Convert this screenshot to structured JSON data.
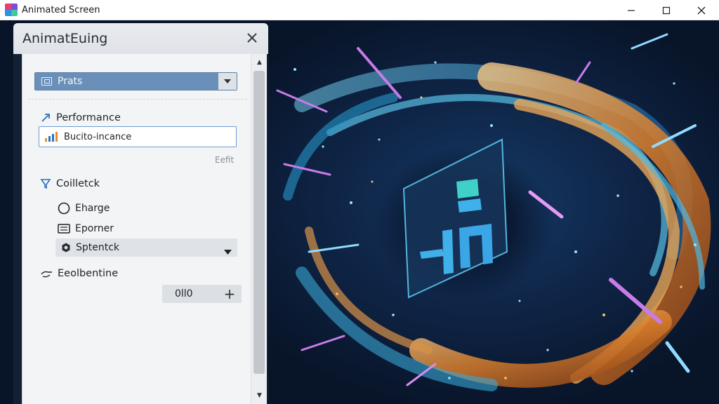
{
  "window": {
    "title": "Animated Screen",
    "controls": [
      "minimize",
      "maximize",
      "close"
    ]
  },
  "panel": {
    "title": "AnimatEuing",
    "top_dropdown": {
      "value": "Prats",
      "icon": "image-frame-icon"
    },
    "performance": {
      "label": "Performance",
      "input_value": "Bucito-incance",
      "edit_label": "Eefit"
    },
    "collection": {
      "label": "Coilletck",
      "options": [
        {
          "label": "Eharge",
          "icon": "circle-radio-icon"
        },
        {
          "label": "Eporner",
          "icon": "keyboard-icon"
        }
      ],
      "select_value": "Sptentck"
    },
    "resolution": {
      "label": "Eeolbentine",
      "stepper_value": "0ll0",
      "plus_label": "+"
    }
  },
  "colors": {
    "accent_dropdown": "#6a8fb8",
    "input_border": "#6f9bd0",
    "panel_bg": "#f3f4f6",
    "swirl_orange": "#f0a04a",
    "swirl_blue": "#3fb6e6",
    "streak_pink": "#c77ce8"
  }
}
